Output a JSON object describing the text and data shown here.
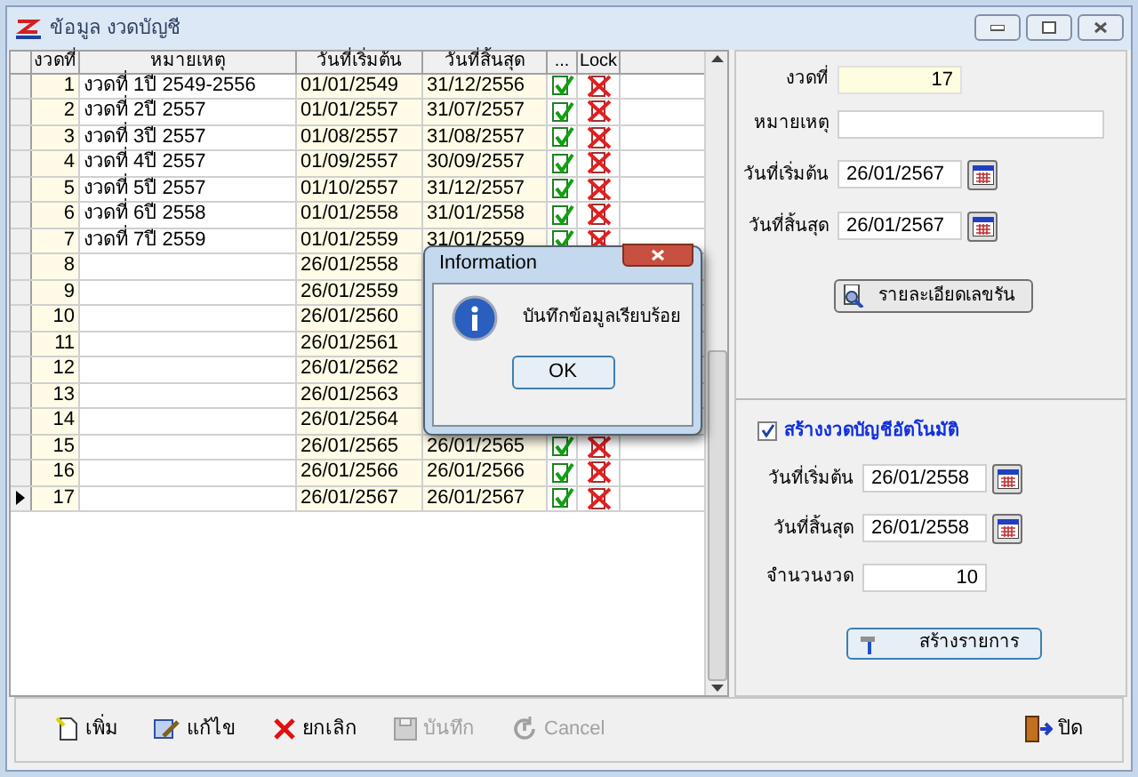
{
  "window": {
    "title": "ข้อมูล งวดบัญชี"
  },
  "grid": {
    "columns": [
      "งวดที่",
      "หมายเหตุ",
      "วันที่เริ่มต้น",
      "วันที่สิ้นสุด",
      "...",
      "Lock"
    ],
    "rows": [
      {
        "no": "1",
        "note": "งวดที่ 1ปี 2549-2556",
        "start": "01/01/2549",
        "end": "31/12/2556",
        "active": true,
        "locked": false,
        "selected": false
      },
      {
        "no": "2",
        "note": "งวดที่ 2ปี 2557",
        "start": "01/01/2557",
        "end": "31/07/2557",
        "active": true,
        "locked": false,
        "selected": false
      },
      {
        "no": "3",
        "note": "งวดที่ 3ปี 2557",
        "start": "01/08/2557",
        "end": "31/08/2557",
        "active": true,
        "locked": false,
        "selected": false
      },
      {
        "no": "4",
        "note": "งวดที่ 4ปี 2557",
        "start": "01/09/2557",
        "end": "30/09/2557",
        "active": true,
        "locked": false,
        "selected": false
      },
      {
        "no": "5",
        "note": "งวดที่ 5ปี 2557",
        "start": "01/10/2557",
        "end": "31/12/2557",
        "active": true,
        "locked": false,
        "selected": false
      },
      {
        "no": "6",
        "note": "งวดที่ 6ปี 2558",
        "start": "01/01/2558",
        "end": "31/01/2558",
        "active": true,
        "locked": false,
        "selected": false
      },
      {
        "no": "7",
        "note": "งวดที่ 7ปี 2559",
        "start": "01/01/2559",
        "end": "31/01/2559",
        "active": true,
        "locked": false,
        "selected": false
      },
      {
        "no": "8",
        "start": "26/01/2558",
        "selected": false
      },
      {
        "no": "9",
        "start": "26/01/2559",
        "selected": false
      },
      {
        "no": "10",
        "start": "26/01/2560",
        "selected": false
      },
      {
        "no": "11",
        "start": "26/01/2561",
        "selected": false
      },
      {
        "no": "12",
        "start": "26/01/2562",
        "selected": false
      },
      {
        "no": "13",
        "start": "26/01/2563",
        "selected": false
      },
      {
        "no": "14",
        "start": "26/01/2564",
        "selected": false
      },
      {
        "no": "15",
        "start": "26/01/2565",
        "end": "26/01/2565",
        "active": true,
        "locked": false,
        "selected": false
      },
      {
        "no": "16",
        "start": "26/01/2566",
        "end": "26/01/2566",
        "active": true,
        "locked": false,
        "selected": false
      },
      {
        "no": "17",
        "start": "26/01/2567",
        "end": "26/01/2567",
        "active": true,
        "locked": false,
        "selected": true
      }
    ]
  },
  "dialog": {
    "title": "Information",
    "message": "บันทึกข้อมูลเรียบร้อย",
    "button": "OK"
  },
  "detail": {
    "fields": [
      {
        "label": "งวดที่",
        "value": "17",
        "kind": "number"
      },
      {
        "label": "หมายเหตุ",
        "kind": "text"
      },
      {
        "label": "วันที่เริ่มต้น",
        "value": "26/01/2567",
        "kind": "date"
      },
      {
        "label": "วันที่สิ้นสุด",
        "value": "26/01/2567",
        "kind": "date"
      }
    ],
    "button": "รายละเอียดเลขรัน"
  },
  "auto": {
    "label": "สร้างงวดบัญชีอัตโนมัติ",
    "checked": true,
    "fields": [
      {
        "label": "วันที่เริ่มต้น",
        "value": "26/01/2558",
        "kind": "date"
      },
      {
        "label": "วันที่สิ้นสุด",
        "value": "26/01/2558",
        "kind": "date"
      },
      {
        "label": "จำนวนงวด",
        "value": "10",
        "kind": "count"
      }
    ],
    "button": "สร้างรายการ"
  },
  "toolbar": [
    {
      "label": "เพิ่ม",
      "kind": "add",
      "disabled": false
    },
    {
      "label": "แก้ไข",
      "kind": "edit",
      "disabled": false
    },
    {
      "label": "ยกเลิก",
      "kind": "delete",
      "disabled": false
    },
    {
      "label": "บันทึก",
      "kind": "save",
      "disabled": true
    },
    {
      "label": "Cancel",
      "kind": "cancel",
      "disabled": true
    },
    {
      "label": "ปิด",
      "kind": "close",
      "disabled": false
    }
  ]
}
